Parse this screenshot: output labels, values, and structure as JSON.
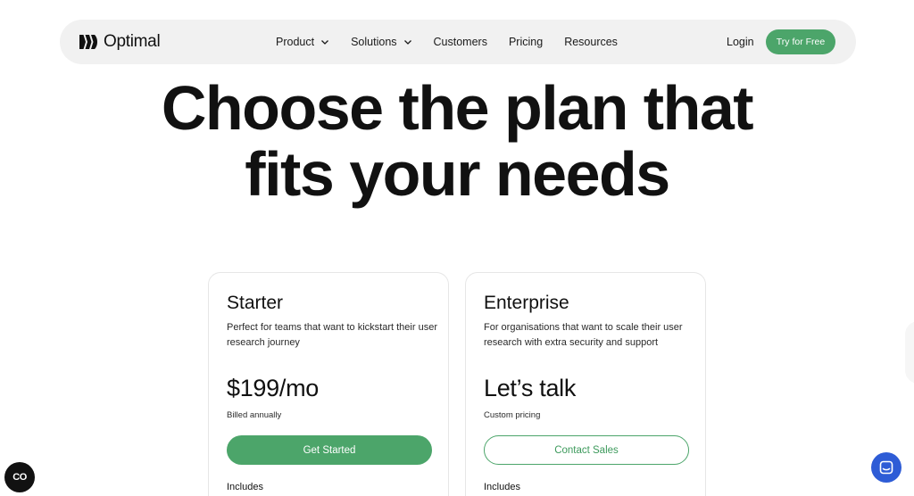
{
  "nav": {
    "logo_text": "Optimal",
    "items": [
      {
        "label": "Product",
        "has_dropdown": true
      },
      {
        "label": "Solutions",
        "has_dropdown": true
      },
      {
        "label": "Customers",
        "has_dropdown": false
      },
      {
        "label": "Pricing",
        "has_dropdown": false
      },
      {
        "label": "Resources",
        "has_dropdown": false
      }
    ],
    "login_label": "Login",
    "cta_label": "Try for Free"
  },
  "hero": {
    "line1": "Choose the plan that",
    "line2": "fits your needs"
  },
  "plans": [
    {
      "name": "Starter",
      "description": "Perfect for teams that want to kickstart their user research journey",
      "price": "$199/mo",
      "price_note": "Billed annually",
      "button_label": "Get Started",
      "includes_label": "Includes"
    },
    {
      "name": "Enterprise",
      "description": "For organisations that want to scale their user research with extra security and support",
      "price": "Let’s talk",
      "price_note": "Custom pricing",
      "button_label": "Contact Sales",
      "includes_label": "Includes"
    }
  ],
  "widgets": {
    "cookie_label": "CO",
    "chat_icon": "chat-icon"
  },
  "colors": {
    "accent": "#4ca56a",
    "chat": "#2e5cd6",
    "nav_bg": "#f1f1f1"
  }
}
